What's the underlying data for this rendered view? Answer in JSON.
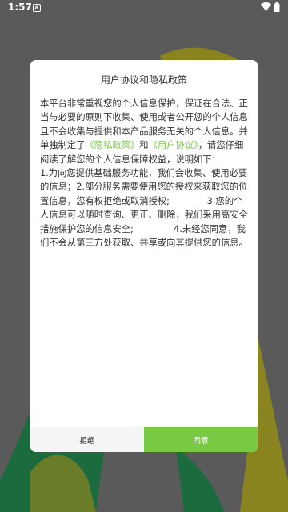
{
  "status_bar": {
    "time": "1:57",
    "app_icon_letter": "A",
    "wifi_icon": "wifi-icon",
    "battery_icon": "battery-icon"
  },
  "colors": {
    "background": "#5a5a5a",
    "art_green": "#1b6b3e",
    "art_olive": "#8a8420",
    "link": "#7bc74c",
    "agree_button": "#7ac943",
    "reject_button": "#f5f5f5"
  },
  "dialog": {
    "title": "用户协议和隐私政策",
    "body_part1": "本平台非常重视您的个人信息保护，保证在合法、正当与必要的原则下收集、使用或者公开您的个人信息且不会收集与提供和本产品服务无关的个人信息。并单独制定了",
    "privacy_link": "《隐私政策》",
    "body_and": "和",
    "agreement_link": "《用户协议》",
    "body_part2": "，请您仔细阅读了解您的个人信息保障权益，说明如下：                1.为向您提供基础服务功能，我们会收集、使用必要的信息；2.部分服务需要使用您的授权来获取您的位置信息，您有权拒绝或取消授权;             3.您的个人信息可以随时查询、更正、删除，我们采用高安全措施保护您的信息安全;              4.未经您同意，我们不会从第三方处获取、共享或向其提供您的信息。",
    "reject_label": "拒绝",
    "agree_label": "同意"
  }
}
